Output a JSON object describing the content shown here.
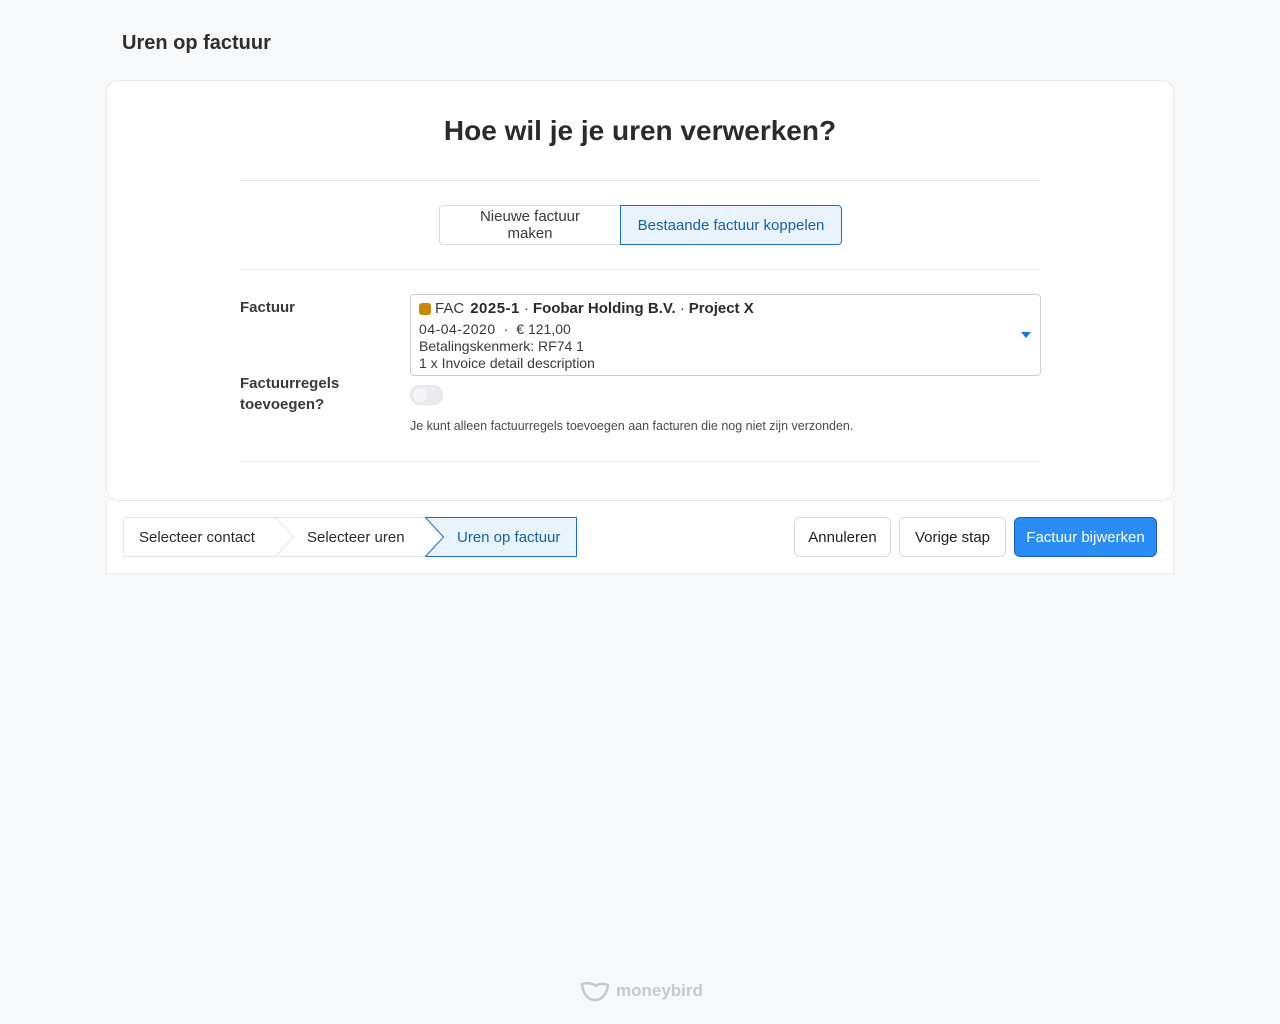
{
  "page": {
    "title": "Uren op factuur"
  },
  "card": {
    "question": "Hoe wil je je uren verwerken?",
    "options": {
      "new_label": "Nieuwe factuur maken",
      "existing_label": "Bestaande factuur koppelen"
    },
    "invoice_label": "Factuur",
    "invoice": {
      "prefix": "FAC",
      "number": "2025-1",
      "separator": "·",
      "contact": "Foobar Holding B.V.",
      "project": "Project X",
      "date": "04-04-2020",
      "dot": "·",
      "amount": "€ 121,00",
      "payment_reference": "Betalingskenmerk: RF74 1",
      "detail": "1 x Invoice detail description",
      "status_color": "#c8860a"
    },
    "add_lines_label_1": "Factuurregels",
    "add_lines_label_2": "toevoegen?",
    "add_lines_enabled": false,
    "hint": "Je kunt alleen factuurregels toevoegen aan facturen die nog niet zijn verzonden."
  },
  "wizard": {
    "steps": [
      {
        "label": "Selecteer contact"
      },
      {
        "label": "Selecteer uren"
      },
      {
        "label": "Uren op factuur"
      }
    ],
    "active_step": 2
  },
  "actions": {
    "cancel_label": "Annuleren",
    "previous_label": "Vorige stap",
    "submit_label": "Factuur bijwerken"
  },
  "brand": {
    "name": "moneybird"
  },
  "colors": {
    "accent": "#2a8cf5",
    "active_border": "#1f6fc5",
    "active_bg": "#e8f3fc"
  }
}
